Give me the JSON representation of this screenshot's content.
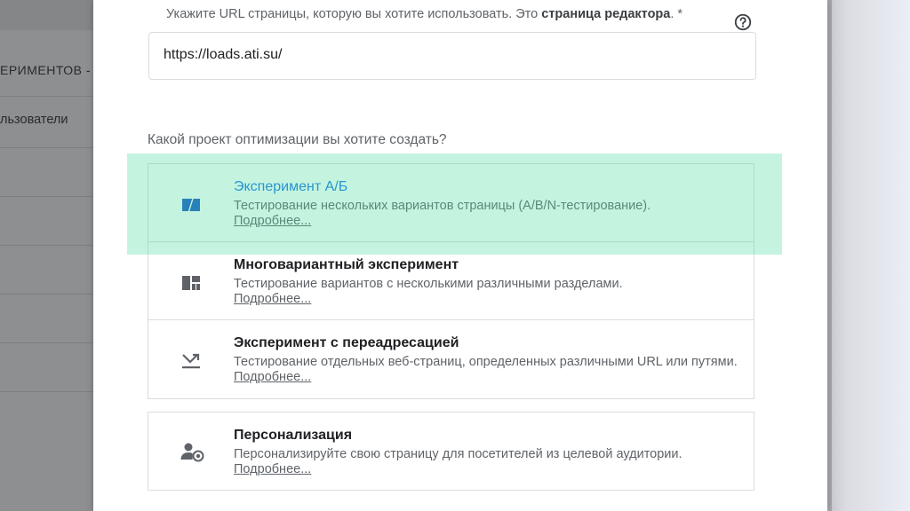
{
  "background": {
    "header_text": "ЕРИМЕНТОВ -",
    "row_text": "льзователи"
  },
  "dialog": {
    "url_label_prefix": "Укажите URL страницы, которую вы хотите использовать. Это ",
    "url_label_bold": "страница редактора",
    "url_label_suffix": ". *",
    "help_icon": "help-circle-icon",
    "url_value": "https://loads.ati.su/",
    "question": "Какой проект оптимизации вы хотите создать?",
    "more_label": "Подробнее...",
    "options": [
      {
        "title": "Эксперимент А/Б",
        "description": "Тестирование нескольких вариантов страницы (A/B/N-тестирование).",
        "icon": "ab-experiment-icon",
        "selected": true
      },
      {
        "title": "Многовариантный эксперимент",
        "description": "Тестирование вариантов с несколькими различными разделами.",
        "icon": "multivariate-grid-icon",
        "selected": false
      },
      {
        "title": "Эксперимент с переадресацией",
        "description": "Тестирование отдельных веб-страниц, определенных различными URL или путями.",
        "icon": "redirect-arrow-icon",
        "selected": false
      }
    ],
    "personalization": {
      "title": "Персонализация",
      "description": "Персонализируйте свою страницу для посетителей из целевой аудитории.",
      "icon": "person-target-icon"
    }
  },
  "colors": {
    "accent": "#1a73e8",
    "highlight": "#48dea0",
    "overlay": "#8f9092"
  }
}
